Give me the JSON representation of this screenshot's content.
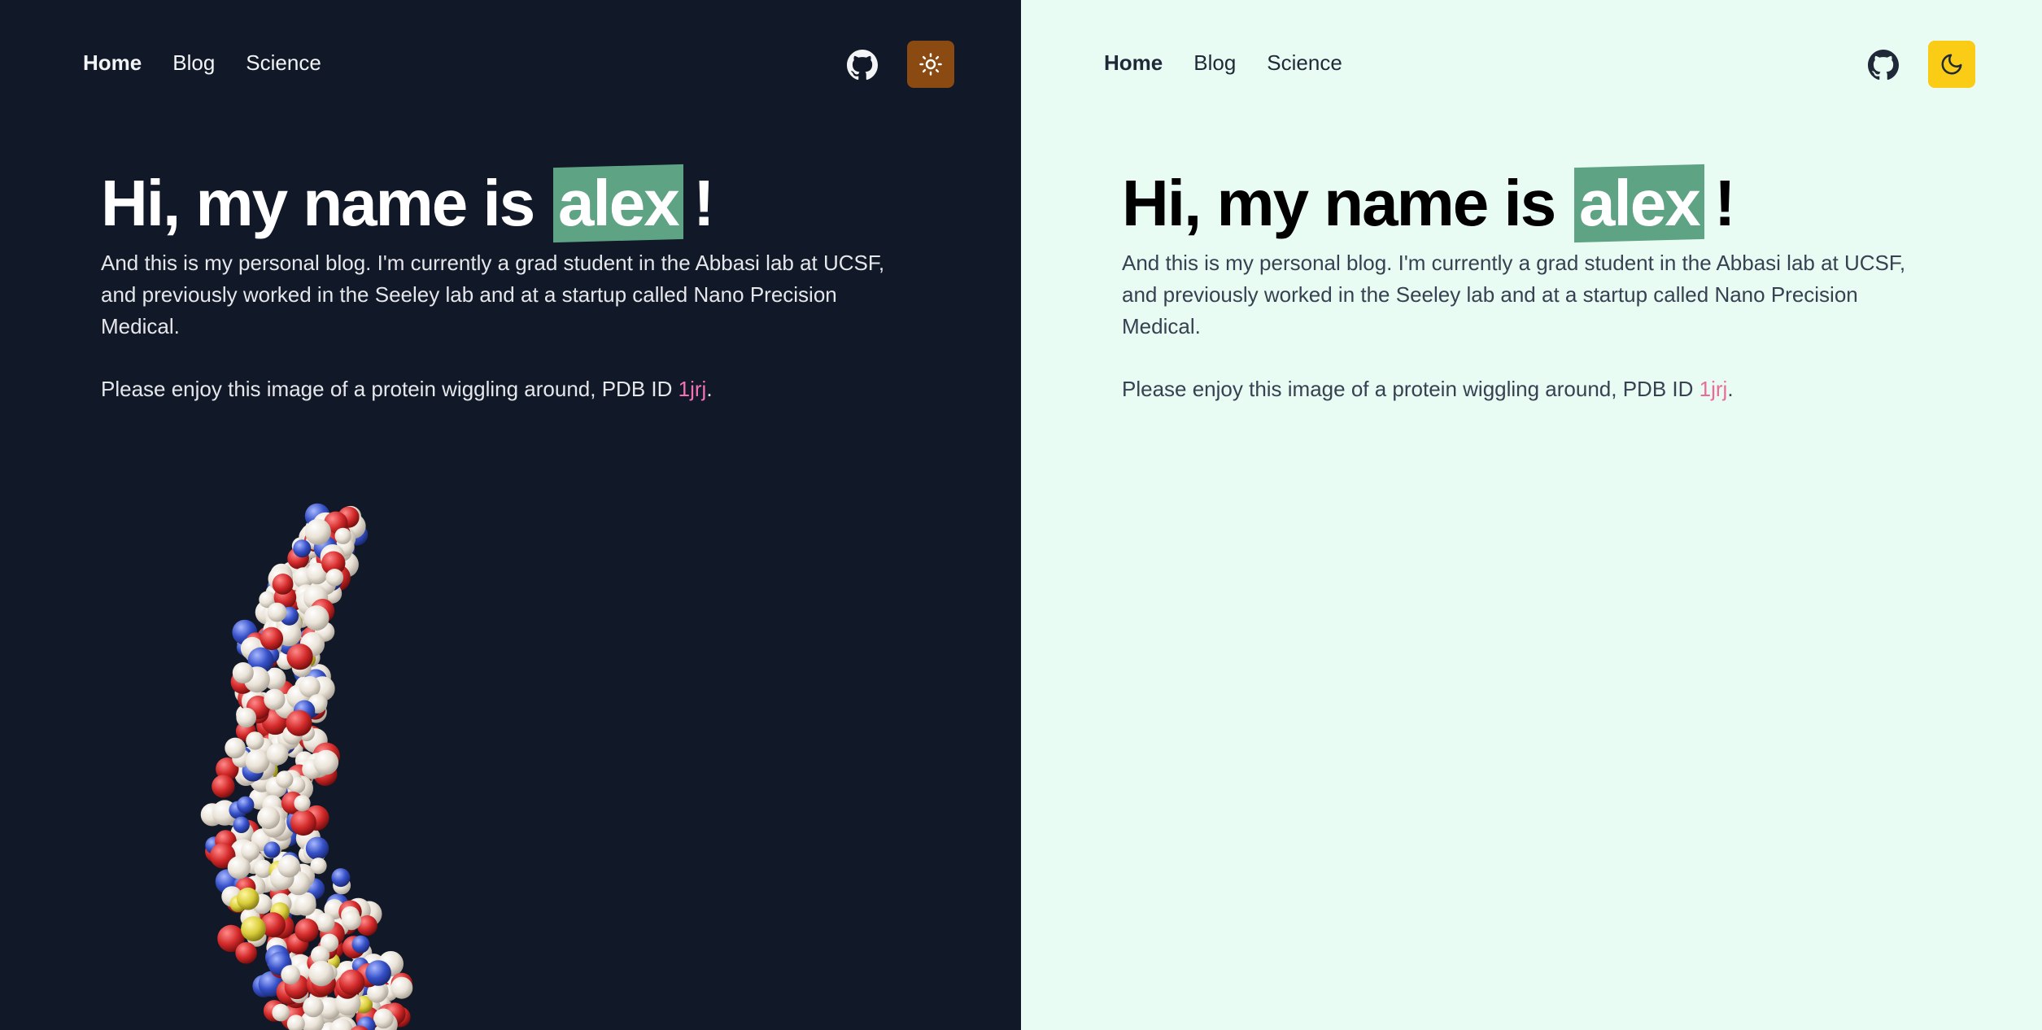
{
  "nav": {
    "items": [
      {
        "label": "Home"
      },
      {
        "label": "Blog"
      },
      {
        "label": "Science"
      }
    ]
  },
  "hero": {
    "greeting": "Hi, my name is",
    "name": "alex",
    "exclaim": "!",
    "intro": "And this is my personal blog. I'm currently a grad student in the Abbasi lab at UCSF, and previously worked in the Seeley lab and at a startup called Nano Precision Medical.",
    "protein_text": "Please enjoy this image of a protein wiggling around, PDB ID",
    "pdb_id": "1jrj",
    "period": "."
  },
  "icons": {
    "github": "github-icon",
    "sun": "sun-icon",
    "moon": "moon-icon"
  },
  "colors": {
    "dark_bg": "#111827",
    "light_bg": "#e8fcf3",
    "highlight": "#5fa385",
    "sun_button": "#8a4a12",
    "moon_button": "#facc15",
    "link": "#f472b6"
  }
}
